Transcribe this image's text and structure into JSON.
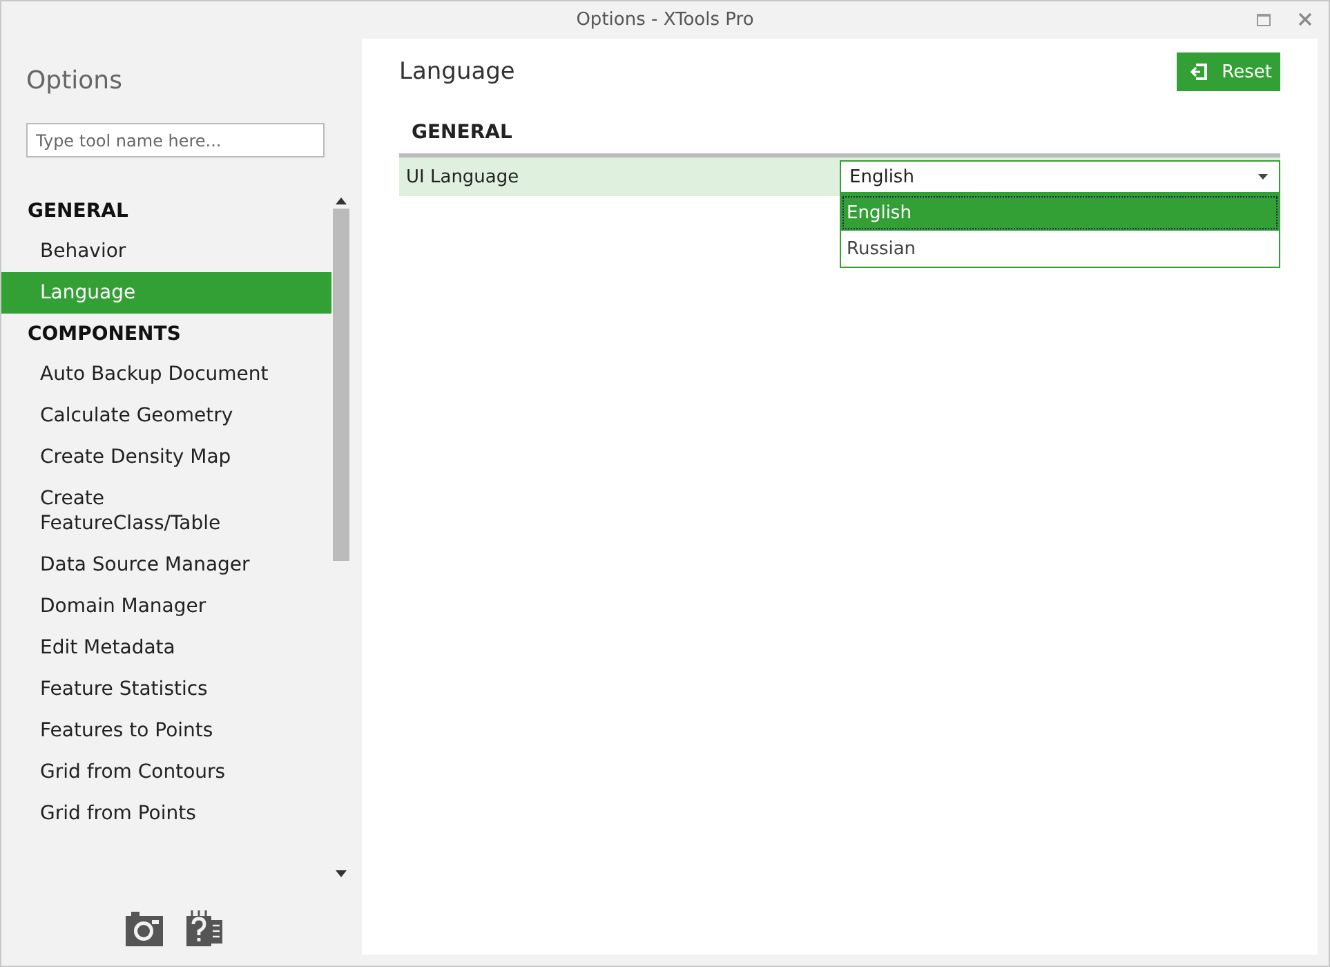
{
  "window": {
    "title": "Options - XTools Pro"
  },
  "sidebar": {
    "title": "Options",
    "search": {
      "placeholder": "Type tool name here..."
    },
    "sections": [
      {
        "heading": "GENERAL",
        "items": [
          {
            "label": "Behavior",
            "selected": false
          },
          {
            "label": "Language",
            "selected": true
          }
        ]
      },
      {
        "heading": "COMPONENTS",
        "items": [
          {
            "label": "Auto Backup Document",
            "selected": false
          },
          {
            "label": "Calculate Geometry",
            "selected": false
          },
          {
            "label": "Create Density Map",
            "selected": false
          },
          {
            "label": "Create FeatureClass/Table",
            "selected": false
          },
          {
            "label": "Data Source Manager",
            "selected": false
          },
          {
            "label": "Domain Manager",
            "selected": false
          },
          {
            "label": "Edit Metadata",
            "selected": false
          },
          {
            "label": "Feature Statistics",
            "selected": false
          },
          {
            "label": "Features to Points",
            "selected": false
          },
          {
            "label": "Grid from Contours",
            "selected": false
          },
          {
            "label": "Grid from Points",
            "selected": false
          }
        ]
      }
    ]
  },
  "content": {
    "title": "Language",
    "reset_button": "Reset",
    "section": "GENERAL",
    "settings": [
      {
        "label": "UI Language",
        "value": "English",
        "expanded": true,
        "options": [
          {
            "label": "English",
            "selected": true
          },
          {
            "label": "Russian",
            "selected": false
          }
        ]
      }
    ]
  }
}
